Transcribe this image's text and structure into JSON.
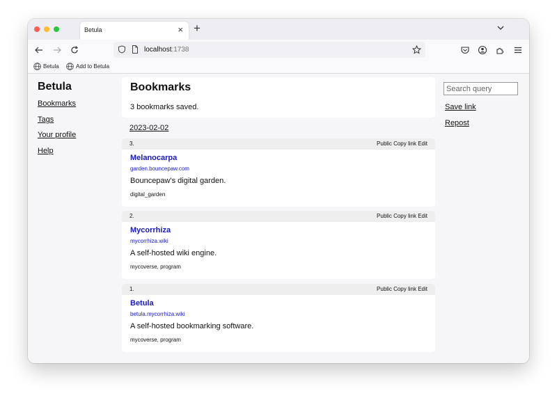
{
  "browser": {
    "tab_title": "Betula",
    "tab_close": "×",
    "new_tab": "+",
    "url_host": "localhost",
    "url_port": ":1738",
    "bookmarks_bar": [
      {
        "label": "Betula",
        "icon": "globe-icon"
      },
      {
        "label": "Add to Betula",
        "icon": "globe-icon"
      }
    ]
  },
  "sidebar": {
    "brand": "Betula",
    "items": [
      {
        "label": "Bookmarks"
      },
      {
        "label": "Tags"
      },
      {
        "label": "Your profile"
      },
      {
        "label": "Help"
      }
    ]
  },
  "main": {
    "title": "Bookmarks",
    "subtitle": "3 bookmarks saved.",
    "date": "2023-02-02",
    "actions": {
      "public": "Public",
      "copy": "Copy link",
      "edit": "Edit"
    },
    "bookmarks": [
      {
        "number": "3.",
        "title": "Melanocarpa",
        "url": "garden.bouncepaw.com",
        "description": "Bouncepaw's digital garden.",
        "tags": "digital_garden"
      },
      {
        "number": "2.",
        "title": "Mycorrhiza",
        "url": "mycorrhiza.wiki",
        "description": "A self-hosted wiki engine.",
        "tags": "mycoverse, program"
      },
      {
        "number": "1.",
        "title": "Betula",
        "url": "betula.mycorrhiza.wiki",
        "description": "A self-hosted bookmarking software.",
        "tags": "mycoverse, program"
      }
    ]
  },
  "right_panel": {
    "search_placeholder": "Search query",
    "save_link": "Save link",
    "repost": "Repost"
  },
  "colors": {
    "link": "#1a1ab8",
    "card": "#ffffff",
    "page_bg": "#f6f6f8",
    "card_header": "#eeeeee"
  }
}
